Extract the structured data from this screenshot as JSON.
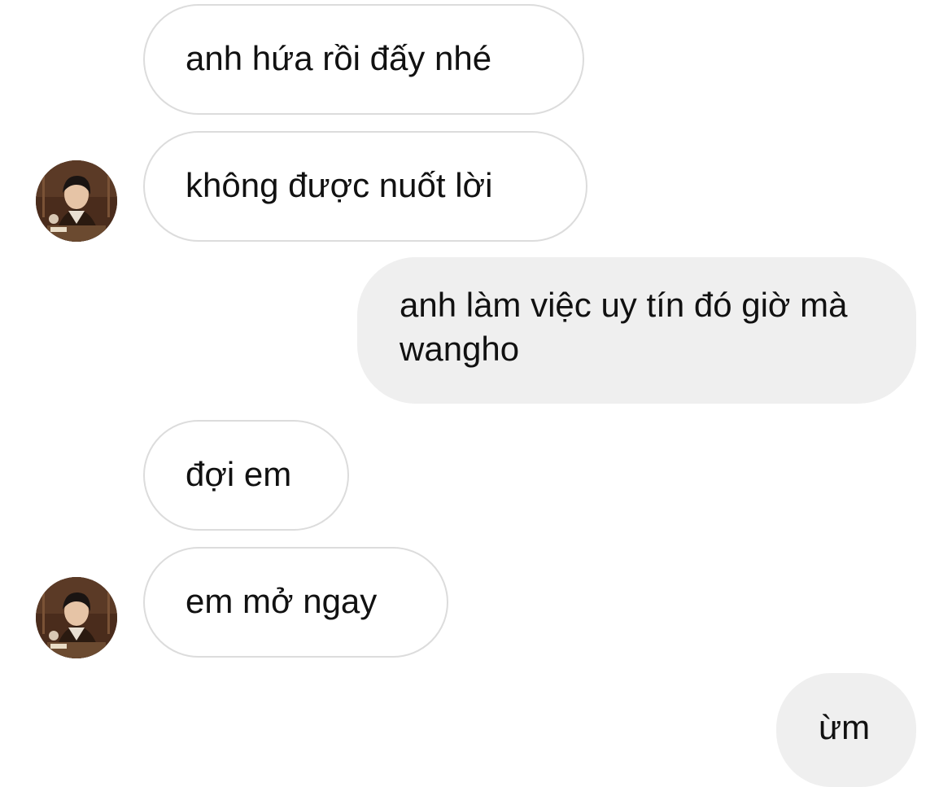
{
  "chat": {
    "messages": [
      {
        "sender": "contact",
        "text": "anh hứa rồi đấy nhé"
      },
      {
        "sender": "contact",
        "text": "không được nuốt lời"
      },
      {
        "sender": "me",
        "text": "anh làm việc uy tín đó giờ mà wangho"
      },
      {
        "sender": "contact",
        "text": "đợi em"
      },
      {
        "sender": "contact",
        "text": "em mở ngay"
      },
      {
        "sender": "me",
        "text": "ừm"
      }
    ],
    "avatar_icon": "contact-profile-photo",
    "colors": {
      "incoming_border": "#dcdcdc",
      "outgoing_bg": "#efefef",
      "text": "#111111"
    }
  }
}
